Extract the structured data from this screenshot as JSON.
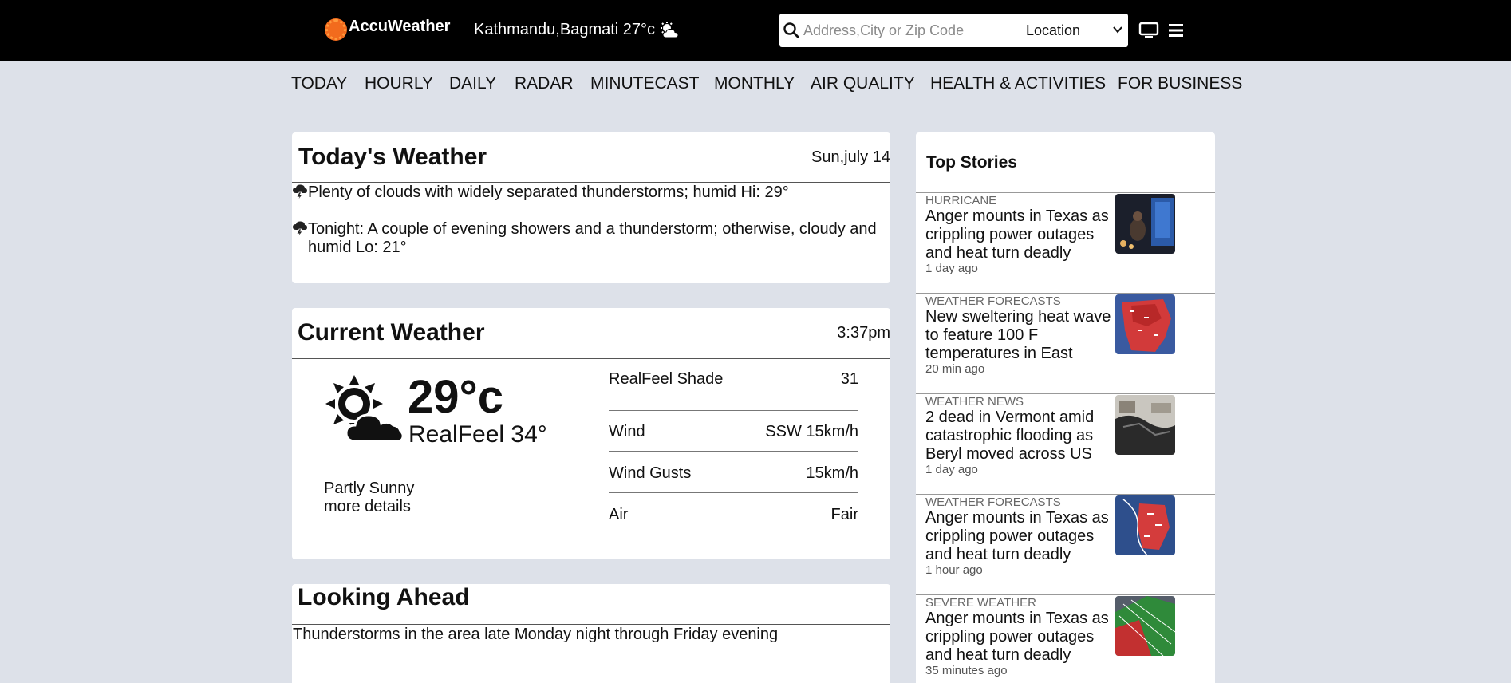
{
  "header": {
    "brand": "AccuWeather",
    "location": "Kathmandu,Bagmati 27°c",
    "search_placeholder": "Address,City or Zip Code",
    "location_select": "Location"
  },
  "nav": {
    "items": [
      "TODAY",
      "HOURLY",
      "DAILY",
      "RADAR",
      "MINUTECAST",
      "MONTHLY",
      "AIR QUALITY",
      "HEALTH & ACTIVITIES",
      "FOR BUSINESS"
    ]
  },
  "today": {
    "title": "Today's Weather",
    "date": "Sun,july 14",
    "day_forecast": "Plenty of clouds with widely separated thunderstorms; humid Hi: 29°",
    "night_forecast": "Tonight: A couple of evening showers and a thunderstorm; otherwise, cloudy and humid Lo: 21°"
  },
  "current": {
    "title": "Current Weather",
    "time": "3:37pm",
    "temp": "29°c",
    "realfeel": "RealFeel 34°",
    "condition": "Partly Sunny",
    "more": "more details",
    "stats": [
      {
        "label": "RealFeel Shade",
        "value": "31"
      },
      {
        "label": "Wind",
        "value": "SSW 15km/h"
      },
      {
        "label": "Wind Gusts",
        "value": "15km/h"
      },
      {
        "label": "Air",
        "value": "Fair"
      }
    ]
  },
  "ahead": {
    "title": "Looking Ahead",
    "text": "Thunderstorms in the area late Monday night through Friday evening"
  },
  "stories": {
    "title": "Top Stories",
    "items": [
      {
        "category": "HURRICANE",
        "title": "Anger mounts in Texas as crippling power outages and heat turn deadly",
        "time": "1 day ago"
      },
      {
        "category": "WEATHER FORECASTS",
        "title": "New sweltering heat wave to feature 100 F temperatures in East",
        "time": "20 min ago"
      },
      {
        "category": "WEATHER NEWS",
        "title": "2 dead in Vermont amid catastrophic flooding as Beryl moved across US",
        "time": "1 day ago"
      },
      {
        "category": "WEATHER FORECASTS",
        "title": "Anger mounts in Texas as crippling power outages and heat turn deadly",
        "time": "1 hour ago"
      },
      {
        "category": "SEVERE WEATHER",
        "title": "Anger mounts in Texas as crippling power outages and heat turn deadly",
        "time": "35 minutes ago"
      }
    ]
  }
}
